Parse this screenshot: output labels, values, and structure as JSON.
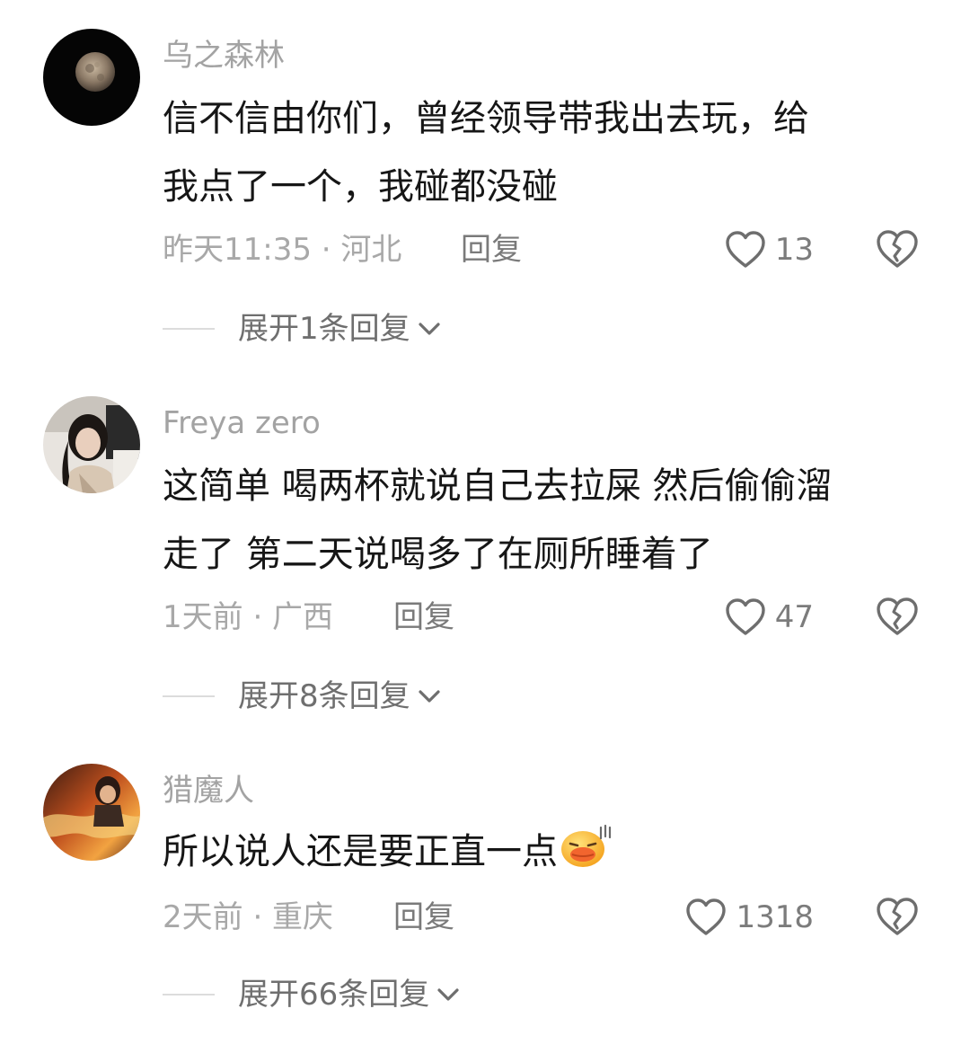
{
  "comments": [
    {
      "username": "乌之森林",
      "text_lines": [
        "信不信由你们，曾经领导带我出去玩，给",
        "我点了一个，我碰都没碰"
      ],
      "time_location": "昨天11:35 · 河北",
      "reply_label": "回复",
      "likes": "13",
      "expand_label": "展开1条回复",
      "avatar_icon": "moon-avatar"
    },
    {
      "username": "Freya zero",
      "text_lines": [
        "这简单 喝两杯就说自己去拉屎 然后偷偷溜",
        "走了 第二天说喝多了在厕所睡着了"
      ],
      "time_location": "1天前 · 广西",
      "reply_label": "回复",
      "likes": "47",
      "expand_label": "展开8条回复",
      "avatar_icon": "girl-avatar"
    },
    {
      "username": "猎魔人",
      "text_lines": [
        "所以说人还是要正直一点"
      ],
      "time_location": "2天前 · 重庆",
      "reply_label": "回复",
      "likes": "1318",
      "expand_label": "展开66条回复",
      "avatar_icon": "anime-avatar",
      "emoji_icon": "embarrassed-duck-emoji"
    }
  ],
  "colors": {
    "username": "#a3a3a3",
    "body_text": "#161616",
    "meta": "#a8a8a8",
    "icon_stroke": "#6e6e6e"
  },
  "icons": {
    "like": "heart-outline-icon",
    "dislike": "broken-heart-icon",
    "expand": "chevron-down-icon"
  }
}
